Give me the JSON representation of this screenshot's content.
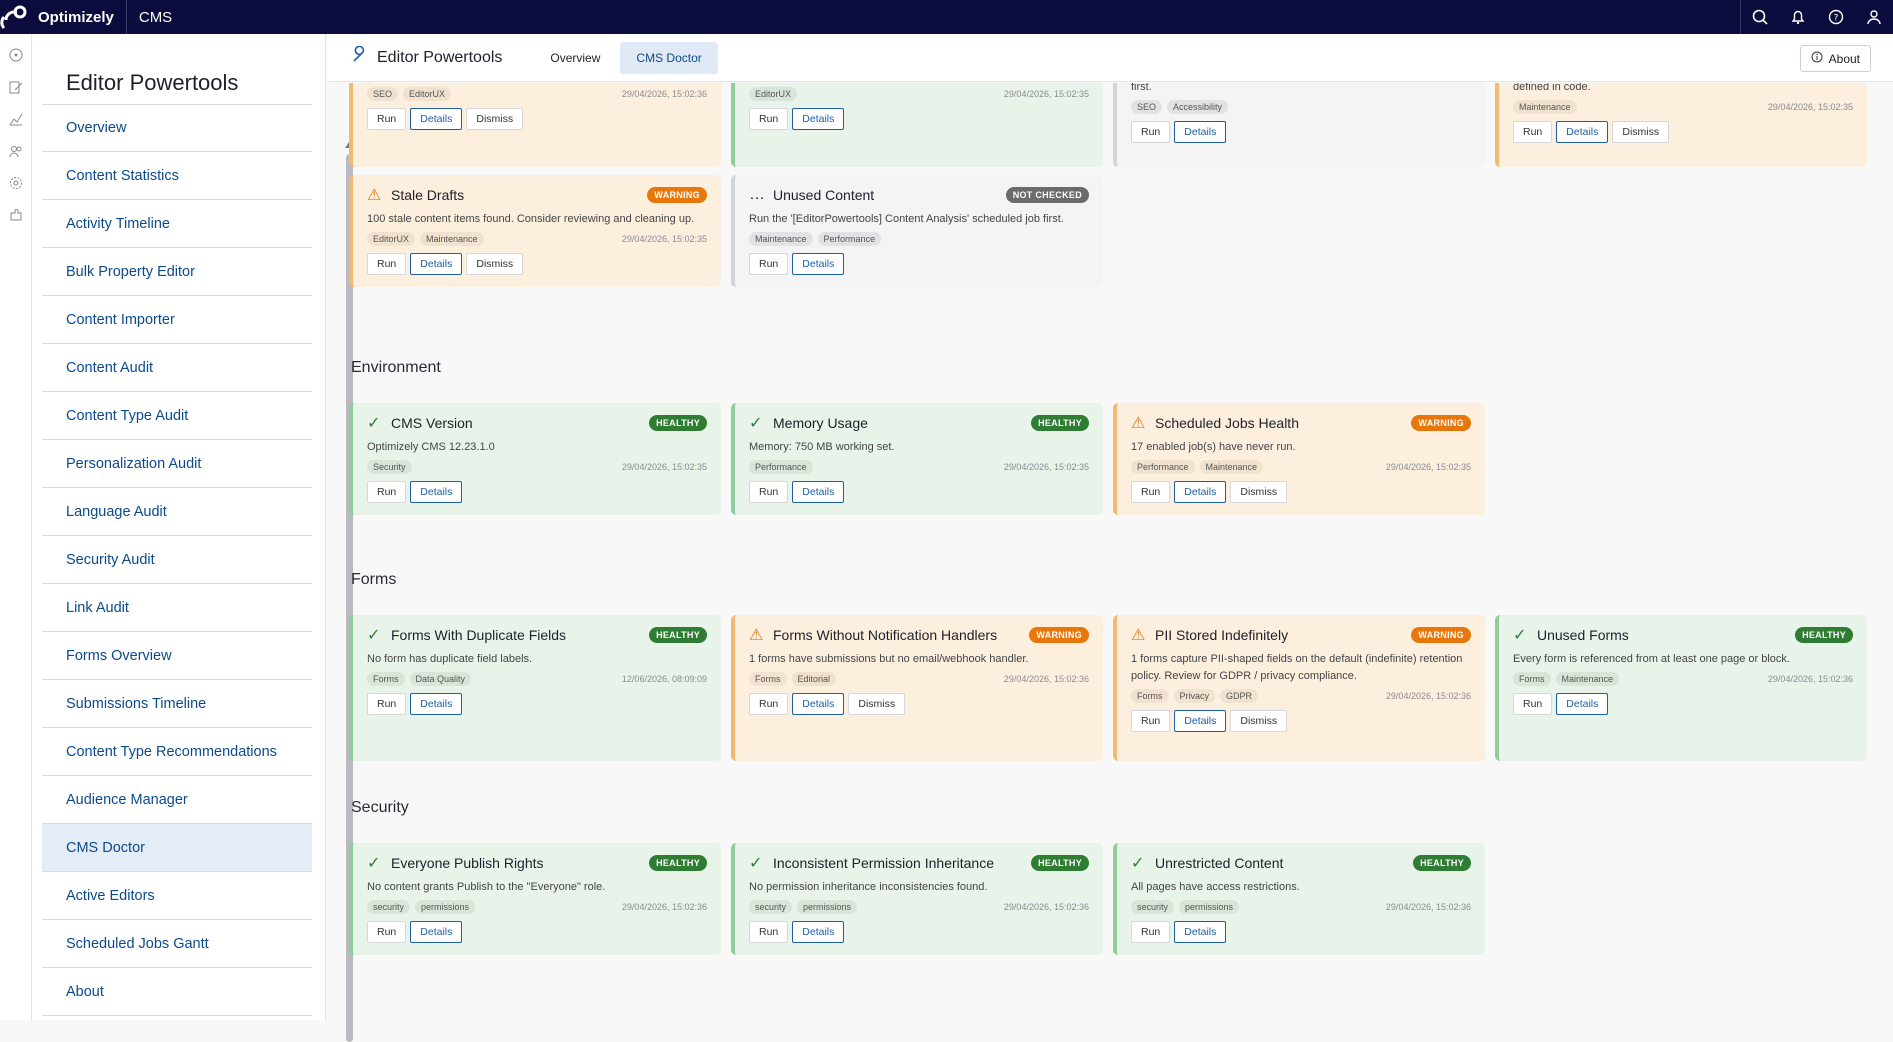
{
  "topbar": {
    "brand": "Optimizely",
    "product": "CMS"
  },
  "sidebar": {
    "title": "Editor Powertools",
    "items": [
      {
        "label": "Overview"
      },
      {
        "label": "Content Statistics"
      },
      {
        "label": "Activity Timeline"
      },
      {
        "label": "Bulk Property Editor"
      },
      {
        "label": "Content Importer"
      },
      {
        "label": "Content Audit"
      },
      {
        "label": "Content Type Audit"
      },
      {
        "label": "Personalization Audit"
      },
      {
        "label": "Language Audit"
      },
      {
        "label": "Security Audit"
      },
      {
        "label": "Link Audit"
      },
      {
        "label": "Forms Overview"
      },
      {
        "label": "Submissions Timeline"
      },
      {
        "label": "Content Type Recommendations"
      },
      {
        "label": "Audience Manager"
      },
      {
        "label": "CMS Doctor"
      },
      {
        "label": "Active Editors"
      },
      {
        "label": "Scheduled Jobs Gantt"
      },
      {
        "label": "About"
      }
    ],
    "active": "CMS Doctor"
  },
  "header": {
    "title": "Editor Powertools",
    "tabs": [
      {
        "label": "Overview"
      },
      {
        "label": "CMS Doctor"
      }
    ],
    "about_label": "About"
  },
  "colors": {
    "topbar": "#0b0b3d",
    "link": "#0b4a8c",
    "healthy": "#2e7d32",
    "warning": "#e8770b",
    "not_checked": "#6b6b6b"
  },
  "partial_cards": [
    {
      "tags": [
        "SEO",
        "EditorUX"
      ],
      "date": "29/04/2026, 15:02:36",
      "actions": [
        "Run",
        "Details",
        "Dismiss"
      ]
    },
    {
      "tags": [
        "EditorUX"
      ],
      "date": "29/04/2026, 15:02:35",
      "actions": [
        "Run",
        "Details"
      ]
    },
    {
      "desc_tail": "first.",
      "tags": [
        "SEO",
        "Accessibility"
      ],
      "date": "",
      "actions": [
        "Run",
        "Details"
      ]
    },
    {
      "desc_tail": "defined in code.",
      "tags": [
        "Maintenance"
      ],
      "date": "29/04/2026, 15:02:35",
      "actions": [
        "Run",
        "Details",
        "Dismiss"
      ]
    }
  ],
  "row2": [
    {
      "title": "Stale Drafts",
      "status": "WARNING",
      "desc": "100 stale content items found. Consider reviewing and cleaning up.",
      "tags": [
        "EditorUX",
        "Maintenance"
      ],
      "date": "29/04/2026, 15:02:35",
      "actions": [
        "Run",
        "Details",
        "Dismiss"
      ]
    },
    {
      "title": "Unused Content",
      "status": "NOT CHECKED",
      "desc": "Run the '[EditorPowertools] Content Analysis' scheduled job first.",
      "tags": [
        "Maintenance",
        "Performance"
      ],
      "date": "",
      "actions": [
        "Run",
        "Details"
      ]
    }
  ],
  "sections": [
    {
      "title": "Environment",
      "cards": [
        {
          "title": "CMS Version",
          "status": "HEALTHY",
          "desc": "Optimizely CMS 12.23.1.0",
          "tags": [
            "Security"
          ],
          "date": "29/04/2026, 15:02:35",
          "actions": [
            "Run",
            "Details"
          ]
        },
        {
          "title": "Memory Usage",
          "status": "HEALTHY",
          "desc": "Memory: 750 MB working set.",
          "tags": [
            "Performance"
          ],
          "date": "29/04/2026, 15:02:35",
          "actions": [
            "Run",
            "Details"
          ]
        },
        {
          "title": "Scheduled Jobs Health",
          "status": "WARNING",
          "desc": "17 enabled job(s) have never run.",
          "tags": [
            "Performance",
            "Maintenance"
          ],
          "date": "29/04/2026, 15:02:35",
          "actions": [
            "Run",
            "Details",
            "Dismiss"
          ]
        }
      ]
    },
    {
      "title": "Forms",
      "cards": [
        {
          "title": "Forms With Duplicate Fields",
          "status": "HEALTHY",
          "desc": "No form has duplicate field labels.",
          "tags": [
            "Forms",
            "Data Quality"
          ],
          "date": "12/06/2026, 08:09:09",
          "actions": [
            "Run",
            "Details"
          ]
        },
        {
          "title": "Forms Without Notification Handlers",
          "status": "WARNING",
          "desc": "1 forms have submissions but no email/webhook handler.",
          "tags": [
            "Forms",
            "Editorial"
          ],
          "date": "29/04/2026, 15:02:36",
          "actions": [
            "Run",
            "Details",
            "Dismiss"
          ]
        },
        {
          "title": "PII Stored Indefinitely",
          "status": "WARNING",
          "desc": "1 forms capture PII-shaped fields on the default (indefinite) retention policy. Review for GDPR / privacy compliance.",
          "tags": [
            "Forms",
            "Privacy",
            "GDPR"
          ],
          "date": "29/04/2026, 15:02:36",
          "actions": [
            "Run",
            "Details",
            "Dismiss"
          ]
        },
        {
          "title": "Unused Forms",
          "status": "HEALTHY",
          "desc": "Every form is referenced from at least one page or block.",
          "tags": [
            "Forms",
            "Maintenance"
          ],
          "date": "29/04/2026, 15:02:36",
          "actions": [
            "Run",
            "Details"
          ]
        }
      ]
    },
    {
      "title": "Security",
      "cards": [
        {
          "title": "Everyone Publish Rights",
          "status": "HEALTHY",
          "desc": "No content grants Publish to the \"Everyone\" role.",
          "tags": [
            "security",
            "permissions"
          ],
          "date": "29/04/2026, 15:02:36",
          "actions": [
            "Run",
            "Details"
          ]
        },
        {
          "title": "Inconsistent Permission Inheritance",
          "status": "HEALTHY",
          "desc": "No permission inheritance inconsistencies found.",
          "tags": [
            "security",
            "permissions"
          ],
          "date": "29/04/2026, 15:02:36",
          "actions": [
            "Run",
            "Details"
          ]
        },
        {
          "title": "Unrestricted Content",
          "status": "HEALTHY",
          "desc": "All pages have access restrictions.",
          "tags": [
            "security",
            "permissions"
          ],
          "date": "29/04/2026, 15:02:36",
          "actions": [
            "Run",
            "Details"
          ]
        }
      ]
    }
  ]
}
